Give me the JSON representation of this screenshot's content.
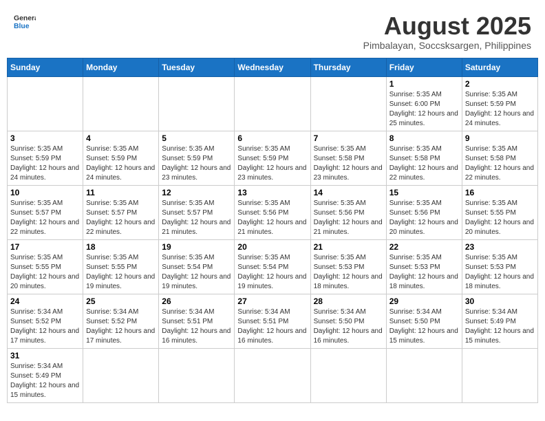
{
  "header": {
    "logo_general": "General",
    "logo_blue": "Blue",
    "title": "August 2025",
    "subtitle": "Pimbalayan, Soccsksargen, Philippines"
  },
  "weekdays": [
    "Sunday",
    "Monday",
    "Tuesday",
    "Wednesday",
    "Thursday",
    "Friday",
    "Saturday"
  ],
  "weeks": [
    [
      {
        "day": "",
        "info": ""
      },
      {
        "day": "",
        "info": ""
      },
      {
        "day": "",
        "info": ""
      },
      {
        "day": "",
        "info": ""
      },
      {
        "day": "",
        "info": ""
      },
      {
        "day": "1",
        "info": "Sunrise: 5:35 AM\nSunset: 6:00 PM\nDaylight: 12 hours and 25 minutes."
      },
      {
        "day": "2",
        "info": "Sunrise: 5:35 AM\nSunset: 5:59 PM\nDaylight: 12 hours and 24 minutes."
      }
    ],
    [
      {
        "day": "3",
        "info": "Sunrise: 5:35 AM\nSunset: 5:59 PM\nDaylight: 12 hours and 24 minutes."
      },
      {
        "day": "4",
        "info": "Sunrise: 5:35 AM\nSunset: 5:59 PM\nDaylight: 12 hours and 24 minutes."
      },
      {
        "day": "5",
        "info": "Sunrise: 5:35 AM\nSunset: 5:59 PM\nDaylight: 12 hours and 23 minutes."
      },
      {
        "day": "6",
        "info": "Sunrise: 5:35 AM\nSunset: 5:59 PM\nDaylight: 12 hours and 23 minutes."
      },
      {
        "day": "7",
        "info": "Sunrise: 5:35 AM\nSunset: 5:58 PM\nDaylight: 12 hours and 23 minutes."
      },
      {
        "day": "8",
        "info": "Sunrise: 5:35 AM\nSunset: 5:58 PM\nDaylight: 12 hours and 22 minutes."
      },
      {
        "day": "9",
        "info": "Sunrise: 5:35 AM\nSunset: 5:58 PM\nDaylight: 12 hours and 22 minutes."
      }
    ],
    [
      {
        "day": "10",
        "info": "Sunrise: 5:35 AM\nSunset: 5:57 PM\nDaylight: 12 hours and 22 minutes."
      },
      {
        "day": "11",
        "info": "Sunrise: 5:35 AM\nSunset: 5:57 PM\nDaylight: 12 hours and 22 minutes."
      },
      {
        "day": "12",
        "info": "Sunrise: 5:35 AM\nSunset: 5:57 PM\nDaylight: 12 hours and 21 minutes."
      },
      {
        "day": "13",
        "info": "Sunrise: 5:35 AM\nSunset: 5:56 PM\nDaylight: 12 hours and 21 minutes."
      },
      {
        "day": "14",
        "info": "Sunrise: 5:35 AM\nSunset: 5:56 PM\nDaylight: 12 hours and 21 minutes."
      },
      {
        "day": "15",
        "info": "Sunrise: 5:35 AM\nSunset: 5:56 PM\nDaylight: 12 hours and 20 minutes."
      },
      {
        "day": "16",
        "info": "Sunrise: 5:35 AM\nSunset: 5:55 PM\nDaylight: 12 hours and 20 minutes."
      }
    ],
    [
      {
        "day": "17",
        "info": "Sunrise: 5:35 AM\nSunset: 5:55 PM\nDaylight: 12 hours and 20 minutes."
      },
      {
        "day": "18",
        "info": "Sunrise: 5:35 AM\nSunset: 5:55 PM\nDaylight: 12 hours and 19 minutes."
      },
      {
        "day": "19",
        "info": "Sunrise: 5:35 AM\nSunset: 5:54 PM\nDaylight: 12 hours and 19 minutes."
      },
      {
        "day": "20",
        "info": "Sunrise: 5:35 AM\nSunset: 5:54 PM\nDaylight: 12 hours and 19 minutes."
      },
      {
        "day": "21",
        "info": "Sunrise: 5:35 AM\nSunset: 5:53 PM\nDaylight: 12 hours and 18 minutes."
      },
      {
        "day": "22",
        "info": "Sunrise: 5:35 AM\nSunset: 5:53 PM\nDaylight: 12 hours and 18 minutes."
      },
      {
        "day": "23",
        "info": "Sunrise: 5:35 AM\nSunset: 5:53 PM\nDaylight: 12 hours and 18 minutes."
      }
    ],
    [
      {
        "day": "24",
        "info": "Sunrise: 5:34 AM\nSunset: 5:52 PM\nDaylight: 12 hours and 17 minutes."
      },
      {
        "day": "25",
        "info": "Sunrise: 5:34 AM\nSunset: 5:52 PM\nDaylight: 12 hours and 17 minutes."
      },
      {
        "day": "26",
        "info": "Sunrise: 5:34 AM\nSunset: 5:51 PM\nDaylight: 12 hours and 16 minutes."
      },
      {
        "day": "27",
        "info": "Sunrise: 5:34 AM\nSunset: 5:51 PM\nDaylight: 12 hours and 16 minutes."
      },
      {
        "day": "28",
        "info": "Sunrise: 5:34 AM\nSunset: 5:50 PM\nDaylight: 12 hours and 16 minutes."
      },
      {
        "day": "29",
        "info": "Sunrise: 5:34 AM\nSunset: 5:50 PM\nDaylight: 12 hours and 15 minutes."
      },
      {
        "day": "30",
        "info": "Sunrise: 5:34 AM\nSunset: 5:49 PM\nDaylight: 12 hours and 15 minutes."
      }
    ],
    [
      {
        "day": "31",
        "info": "Sunrise: 5:34 AM\nSunset: 5:49 PM\nDaylight: 12 hours and 15 minutes."
      },
      {
        "day": "",
        "info": ""
      },
      {
        "day": "",
        "info": ""
      },
      {
        "day": "",
        "info": ""
      },
      {
        "day": "",
        "info": ""
      },
      {
        "day": "",
        "info": ""
      },
      {
        "day": "",
        "info": ""
      }
    ]
  ]
}
